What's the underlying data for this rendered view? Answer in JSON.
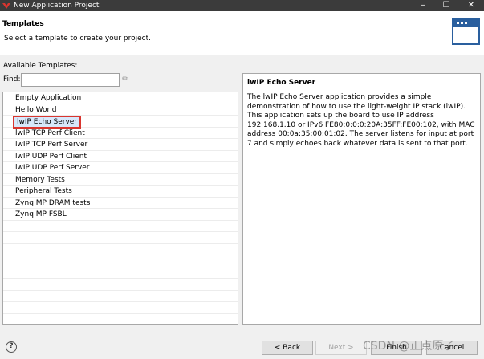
{
  "window": {
    "title": "New Application Project"
  },
  "banner": {
    "heading": "Templates",
    "description": "Select a template to create your project."
  },
  "available_label": "Available Templates:",
  "find": {
    "label": "Find:",
    "value": "",
    "placeholder": ""
  },
  "templates": [
    "Empty Application",
    "Hello World",
    "lwIP Echo Server",
    "lwIP TCP Perf Client",
    "lwIP TCP Perf Server",
    "lwIP UDP Perf Client",
    "lwIP UDP Perf Server",
    "Memory Tests",
    "Peripheral Tests",
    "Zynq MP DRAM tests",
    "Zynq MP FSBL"
  ],
  "selected_template": "lwIP Echo Server",
  "detail": {
    "title": "lwIP Echo Server",
    "text": "The lwIP Echo Server application provides a simple demonstration of how to use the light-weight IP stack (lwIP). This application sets up the board to use IP address 192.168.1.10 or IPv6 FE80:0:0:0:20A:35FF:FE00:102, with MAC address 00:0a:35:00:01:02. The server listens for input at port 7 and simply echoes back whatever data is sent to that port."
  },
  "buttons": {
    "back": "< Back",
    "next": "Next >",
    "finish": "Finish",
    "cancel": "Cancel"
  },
  "watermark": "CSDN @正点原子",
  "colors": {
    "titlebar": "#3b3b3b",
    "selection_border": "#d9352f",
    "selection_fill": "#d7e8fb",
    "wizard_icon": "#2a5f9e"
  }
}
